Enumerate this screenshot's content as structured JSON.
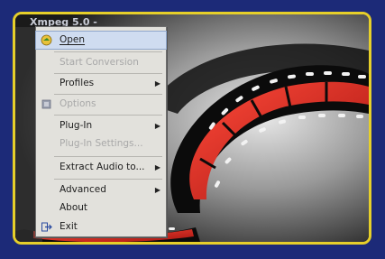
{
  "window": {
    "title": "Xmpeg 5.0 -"
  },
  "menu": {
    "items": [
      {
        "label": "Open",
        "enabled": true,
        "submenu": false,
        "icon": "open-icon"
      },
      {
        "label": "Start Conversion",
        "enabled": false,
        "submenu": false
      },
      {
        "label": "Profiles",
        "enabled": true,
        "submenu": true
      },
      {
        "label": "Options",
        "enabled": false,
        "submenu": false,
        "icon": "options-icon"
      },
      {
        "label": "Plug-In",
        "enabled": true,
        "submenu": true
      },
      {
        "label": "Plug-In Settings...",
        "enabled": false,
        "submenu": false
      },
      {
        "label": "Extract Audio to...",
        "enabled": true,
        "submenu": true
      },
      {
        "label": "Advanced",
        "enabled": true,
        "submenu": true
      },
      {
        "label": "About",
        "enabled": true,
        "submenu": false
      },
      {
        "label": "Exit",
        "enabled": true,
        "submenu": false,
        "icon": "exit-icon"
      }
    ],
    "arrow_glyph": "▶"
  },
  "colors": {
    "border": "#e6cf2a",
    "background": "#1c2a78",
    "menu_bg": "#e2e1dc",
    "film_red": "#e0251f"
  }
}
